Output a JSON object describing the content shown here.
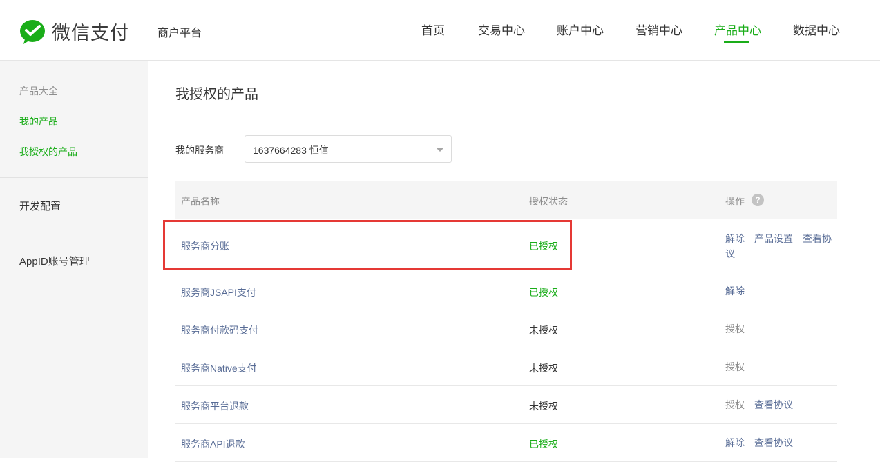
{
  "brand": {
    "name": "微信支付",
    "sub": "商户平台",
    "accent": "#1aad19"
  },
  "nav": {
    "items": [
      "首页",
      "交易中心",
      "账户中心",
      "营销中心",
      "产品中心",
      "数据中心"
    ],
    "active": "产品中心"
  },
  "sidebar": {
    "group_title": "产品大全",
    "links": [
      "我的产品",
      "我授权的产品"
    ],
    "items": [
      "开发配置",
      "AppID账号管理"
    ]
  },
  "main": {
    "title": "我授权的产品",
    "provider_label": "我的服务商",
    "provider_value": "1637664283 恒信"
  },
  "table": {
    "headers": {
      "name": "产品名称",
      "status": "授权状态",
      "ops": "操作"
    },
    "help_icon": "question-icon",
    "help_glyph": "?",
    "rows": [
      {
        "name": "服务商分账",
        "status": "已授权",
        "ops": [
          "解除",
          "产品设置",
          "查看协议"
        ]
      },
      {
        "name": "服务商JSAPI支付",
        "status": "已授权",
        "ops": [
          "解除"
        ]
      },
      {
        "name": "服务商付款码支付",
        "status": "未授权",
        "ops": [
          "授权"
        ]
      },
      {
        "name": "服务商Native支付",
        "status": "未授权",
        "ops": [
          "授权"
        ]
      },
      {
        "name": "服务商平台退款",
        "status": "未授权",
        "ops": [
          "授权",
          "查看协议"
        ]
      },
      {
        "name": "服务商API退款",
        "status": "已授权",
        "ops": [
          "解除",
          "查看协议"
        ]
      }
    ]
  },
  "highlight_color": "#e53935"
}
